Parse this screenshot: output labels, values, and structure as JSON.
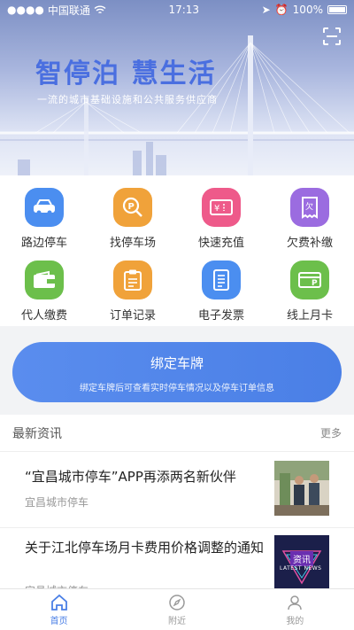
{
  "status_bar": {
    "carrier": "中国联通",
    "time": "17:13",
    "battery": "100%"
  },
  "hero": {
    "title": "智停泊 慧生活",
    "subtitle": "一流的城市基础设施和公共服务供应商"
  },
  "services": [
    {
      "label": "路边停车",
      "icon": "car-icon",
      "color": "#4b8ef0"
    },
    {
      "label": "找停车场",
      "icon": "parking-search-icon",
      "color": "#f0a23a"
    },
    {
      "label": "快速充值",
      "icon": "recharge-card-icon",
      "color": "#ee5a8a"
    },
    {
      "label": "欠费补缴",
      "icon": "arrears-receipt-icon",
      "color": "#9b6ce0"
    },
    {
      "label": "代人缴费",
      "icon": "wallet-icon",
      "color": "#6cbf4b"
    },
    {
      "label": "订单记录",
      "icon": "clipboard-icon",
      "color": "#f0a23a"
    },
    {
      "label": "电子发票",
      "icon": "invoice-icon",
      "color": "#4b8ef0"
    },
    {
      "label": "线上月卡",
      "icon": "monthly-card-icon",
      "color": "#6cbf4b"
    }
  ],
  "bind": {
    "title": "绑定车牌",
    "description": "绑定车牌后可查看实时停车情况以及停车订单信息"
  },
  "news": {
    "header": "最新资讯",
    "more": "更多",
    "items": [
      {
        "title": "“宜昌城市停车”APP再添两名新伙伴",
        "source": "宜昌城市停车"
      },
      {
        "title": "关于江北停车场月卡费用价格调整的通知",
        "source": "宜昌城市停车",
        "thumb_text": "资讯",
        "thumb_sub": "LATEST NEWS"
      }
    ]
  },
  "tabs": [
    {
      "label": "首页",
      "active": true
    },
    {
      "label": "附近",
      "active": false
    },
    {
      "label": "我的",
      "active": false
    }
  ],
  "colors": {
    "primary": "#4a7fe6"
  }
}
